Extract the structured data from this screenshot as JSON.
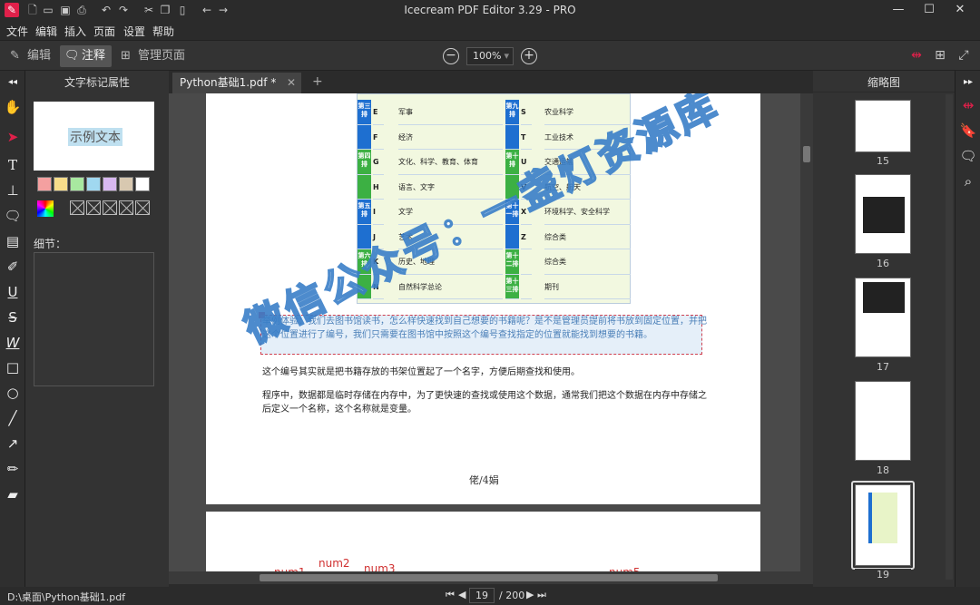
{
  "app": {
    "title": "Icecream PDF Editor 3.29 - PRO"
  },
  "window_controls": {
    "minimize": "—",
    "maximize": "☐",
    "close": "✕"
  },
  "menu": [
    "文件",
    "编辑",
    "插入",
    "页面",
    "设置",
    "帮助"
  ],
  "modes": {
    "edit": "编辑",
    "annotate": "注释",
    "manage": "管理页面"
  },
  "zoom": {
    "value": "100%",
    "arrow": "▾",
    "minus": "−",
    "plus": "+"
  },
  "props_panel": {
    "title": "文字标记属性",
    "sample_text": "示例文本",
    "swatches": [
      "#f4a0a0",
      "#f7dd8a",
      "#a8e8a0",
      "#a0d8f0",
      "#d8b8f0",
      "#d8c8b0",
      "#ffffff"
    ],
    "detail_label": "细节："
  },
  "tab": {
    "label": "Python基础1.pdf *",
    "close": "✕",
    "add": "+"
  },
  "document": {
    "table_rows": [
      {
        "col1": "第三排",
        "l1": "E",
        "t1": "军事",
        "col2": "第九排",
        "l2": "S",
        "t2": "农业科学"
      },
      {
        "col1": "",
        "l1": "F",
        "t1": "经济",
        "col2": "",
        "l2": "T",
        "t2": "工业技术"
      },
      {
        "col1": "第四排",
        "l1": "G",
        "t1": "文化、科学、教育、体育",
        "col2": "第十排",
        "l2": "U",
        "t2": "交通运输"
      },
      {
        "col1": "",
        "l1": "H",
        "t1": "语言、文字",
        "col2": "",
        "l2": "V",
        "t2": "航空、航天"
      },
      {
        "col1": "第五排",
        "l1": "I",
        "t1": "文学",
        "col2": "第十一排",
        "l2": "X",
        "t2": "环境科学、安全科学"
      },
      {
        "col1": "",
        "l1": "J",
        "t1": "艺术",
        "col2": "",
        "l2": "Z",
        "t2": "综合类"
      },
      {
        "col1": "第六排",
        "l1": "K",
        "t1": "历史、地理",
        "col2": "第十二排",
        "l2": "",
        "t2": "综合类"
      },
      {
        "col1": "",
        "l1": "N",
        "t1": "自然科学总论",
        "col2": "第十三排",
        "l2": "",
        "t2": "期刊"
      }
    ],
    "selected_paragraph": "举例体验：我们去图书馆读书，怎么样快速找到自己想要的书籍呢？是不是管理员提前将书放到固定位置，并把这个位置进行了编号，我们只需要在图书馆中按照这个编号查找指定的位置就能找到想要的书籍。",
    "paragraph2": "这个编号其实就是把书籍存放的书架位置起了一个名字，方便后期查找和使用。",
    "paragraph3": "程序中，数据都是临时存储在内存中，为了更快速的查找或使用这个数据，通常我们把这个数据在内存中存储之后定义一个名称，这个名称就是变量。",
    "page_footer": "佬/4娟",
    "next_page_labels": [
      "num1",
      "num2",
      "num3",
      "num5"
    ],
    "watermark": "微信公众号：一盏灯资源库"
  },
  "thumbnails": {
    "title": "缩略图",
    "pages": [
      "15",
      "16",
      "17",
      "18",
      "19"
    ],
    "selected": "19"
  },
  "status": {
    "path": "D:\\桌面\\Python基础1.pdf",
    "current_page": "19",
    "total": "/ 200"
  },
  "colors": {
    "accent": "#e0204a",
    "blue_col": "#1e6fd0",
    "green_col": "#3cb043",
    "table_bg": "#f2f8e0"
  }
}
